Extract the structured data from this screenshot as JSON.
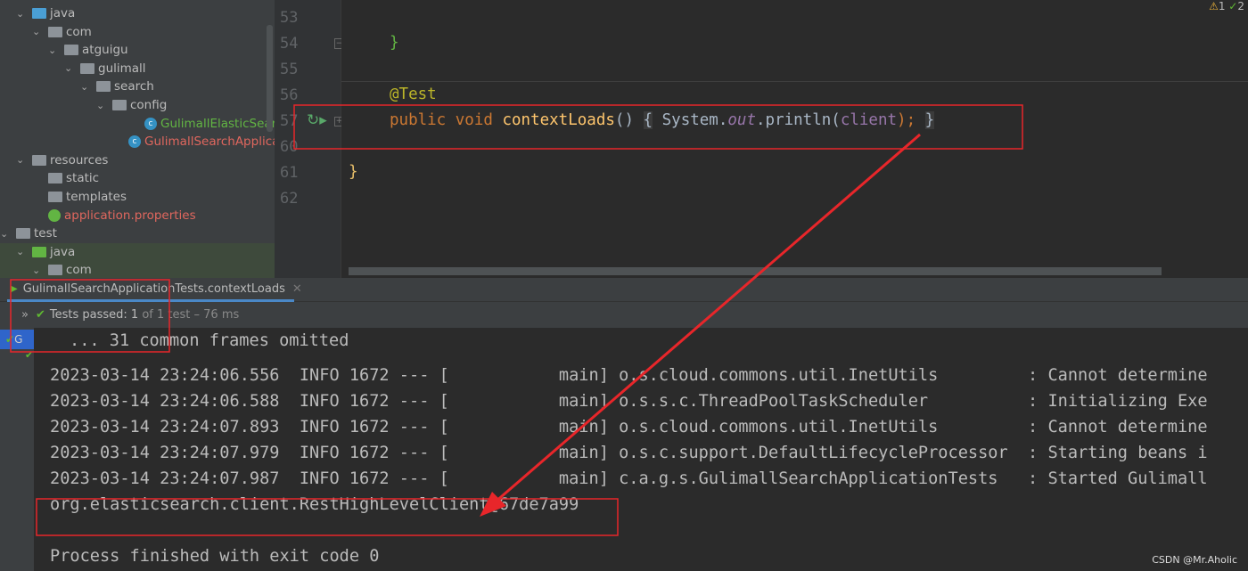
{
  "project_tree": {
    "items": [
      {
        "label": "java",
        "type": "folder-blue",
        "depth": 2,
        "chev": "v"
      },
      {
        "label": "com",
        "type": "package",
        "depth": 3,
        "chev": "v"
      },
      {
        "label": "atguigu",
        "type": "package",
        "depth": 4,
        "chev": "v"
      },
      {
        "label": "gulimall",
        "type": "package",
        "depth": 5,
        "chev": "v"
      },
      {
        "label": "search",
        "type": "package",
        "depth": 6,
        "chev": "v"
      },
      {
        "label": "config",
        "type": "package",
        "depth": 7,
        "chev": "v"
      },
      {
        "label": "GulimallElasticSearchConfig",
        "type": "class",
        "depth": 9,
        "chev": ""
      },
      {
        "label": "GulimallSearchApplication",
        "type": "spring-class",
        "depth": 8,
        "chev": ""
      },
      {
        "label": "resources",
        "type": "folder",
        "depth": 2,
        "chev": "v"
      },
      {
        "label": "static",
        "type": "folder",
        "depth": 3,
        "chev": ""
      },
      {
        "label": "templates",
        "type": "folder",
        "depth": 3,
        "chev": ""
      },
      {
        "label": "application.properties",
        "type": "properties",
        "depth": 3,
        "chev": ""
      },
      {
        "label": "test",
        "type": "folder",
        "depth": 1,
        "chev": "v"
      },
      {
        "label": "java",
        "type": "folder-green",
        "depth": 2,
        "chev": "v"
      },
      {
        "label": "com",
        "type": "package",
        "depth": 3,
        "chev": "v"
      }
    ]
  },
  "editor": {
    "line_numbers": [
      "53",
      "54",
      "55",
      "56",
      "57",
      "60",
      "61",
      "62"
    ],
    "code": {
      "brace_close": "}",
      "annotation": "@Test",
      "kw_public": "public",
      "kw_void": "void",
      "method": "contextLoads",
      "parens": "()",
      "open_brace": "{",
      "system": "System.",
      "out": "out",
      ".println(": ".println(",
      "client": "client",
      "end": ");",
      "close_brace": "}",
      "class_close": "}"
    },
    "inspections": {
      "warnings": "1",
      "ok": "2"
    }
  },
  "run_panel": {
    "tab_label": "GulimallSearchApplicationTests.contextLoads",
    "status_prefix": "Tests passed:",
    "status_count": "1",
    "status_rest": "of 1 test – 76 ms",
    "tree_item": "G"
  },
  "console": {
    "omitted": "... 31 common frames omitted",
    "lines": [
      "2023-03-14 23:24:06.556  INFO 1672 --- [           main] o.s.cloud.commons.util.InetUtils         : Cannot determine",
      "2023-03-14 23:24:06.588  INFO 1672 --- [           main] o.s.s.c.ThreadPoolTaskScheduler          : Initializing Exe",
      "2023-03-14 23:24:07.893  INFO 1672 --- [           main] o.s.cloud.commons.util.InetUtils         : Cannot determine",
      "2023-03-14 23:24:07.979  INFO 1672 --- [           main] o.s.c.support.DefaultLifecycleProcessor  : Starting beans i",
      "2023-03-14 23:24:07.987  INFO 1672 --- [           main] c.a.g.s.GulimallSearchApplicationTests   : Started Gulimall"
    ],
    "client_output": "org.elasticsearch.client.RestHighLevelClient@67de7a99",
    "exit": "Process finished with exit code 0"
  },
  "watermark": "CSDN @Mr.Aholic",
  "colors": {
    "annotation_red": "#e8262a",
    "pass_green": "#5fb832"
  }
}
